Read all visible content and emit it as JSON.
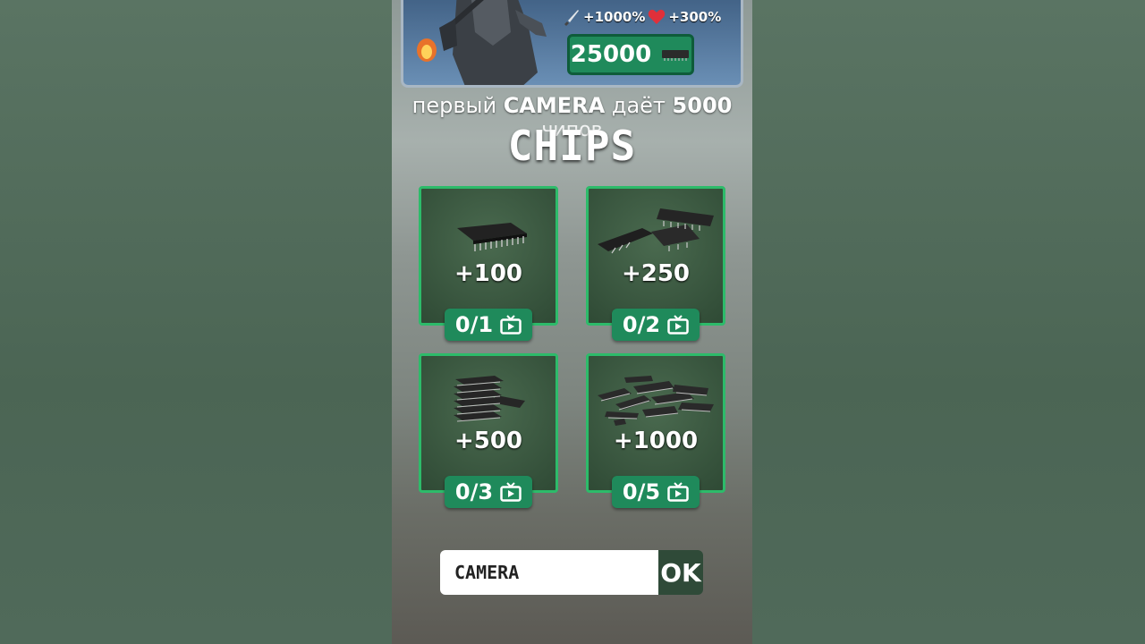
{
  "offer": {
    "damage_bonus": "+1000%",
    "health_bonus": "+300%",
    "price": "25000",
    "icons": {
      "damage": "knife-icon",
      "health": "heart-icon",
      "currency": "chip-icon"
    }
  },
  "bonus_text": {
    "prefix": "первый",
    "code": "CAMERA",
    "middle": "даёт",
    "amount": "5000",
    "line2": "чипов"
  },
  "title": "CHIPS",
  "rewards": [
    {
      "amount": "+100",
      "progress": "0/1"
    },
    {
      "amount": "+250",
      "progress": "0/2"
    },
    {
      "amount": "+500",
      "progress": "0/3"
    },
    {
      "amount": "+1000",
      "progress": "0/5"
    }
  ],
  "code_input": {
    "value": "CAMERA"
  },
  "ok_label": "OK",
  "colors": {
    "accent_green": "#1f8a5b",
    "card_border": "#2dbb6a",
    "banner_blue": "#4a6d94"
  }
}
